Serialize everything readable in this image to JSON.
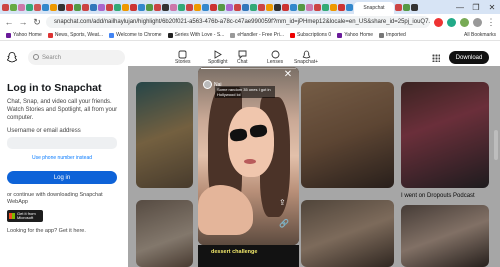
{
  "browser": {
    "url": "snapchat.com/add/nailhaylujan/highlight/6b20f021-a563-476b-a78c-c47ae990059f?mm_id=jPHmep12&locale=en_US&share_id=25pj_iouQ7...",
    "active_tab": "Snapchat",
    "window_controls": [
      "—",
      "❐",
      "✕"
    ],
    "bookmarks": [
      "Yahoo Home",
      "News, Sports, Weat...",
      "Welcome to Chrome",
      "Series With Love - S...",
      "eHandler - Free Pri...",
      "Subscriptions 0",
      "Yahoo Home",
      "Imported"
    ],
    "all_bookmarks": "All Bookmarks"
  },
  "header": {
    "search_placeholder": "Search",
    "nav": [
      "Stories",
      "Spotlight",
      "Chat",
      "Lenses",
      "Snapchat+"
    ],
    "download_label": "Download"
  },
  "login": {
    "title": "Log in to Snapchat",
    "description": "Chat, Snap, and video call your friends. Watch Stories and Spotlight, all from your computer.",
    "username_label": "Username or email address",
    "phone_link": "Use phone number instead",
    "login_button": "Log in",
    "or_text": "or continue with downloading Snapchat WebApp",
    "ms_line1": "Get it from",
    "ms_line2": "Microsoft",
    "looking_text": "Looking for the app? Get it here."
  },
  "viewer": {
    "author": "Nai",
    "caption": "Some random 35 ones I got in Hollywood lol",
    "sticker": "dessert challenge",
    "close_icon": "✕"
  },
  "grid": {
    "caption_right": "I went on Dropouts Podcast"
  }
}
